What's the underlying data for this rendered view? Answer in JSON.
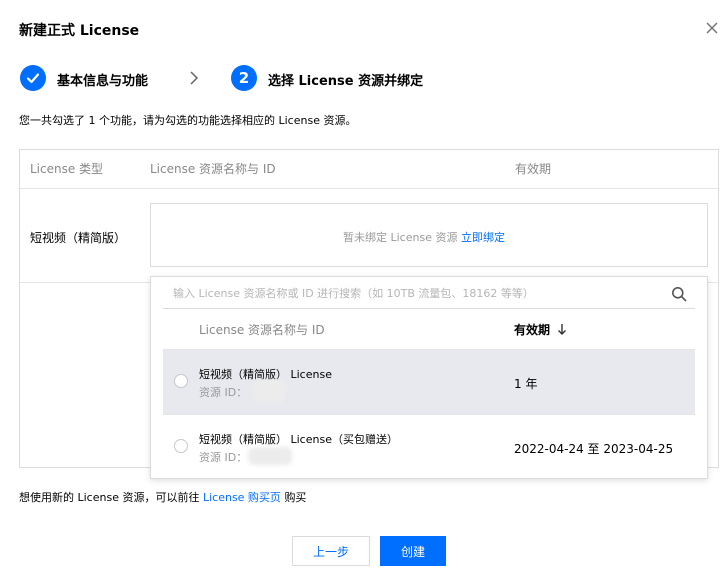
{
  "dialog": {
    "title": "新建正式 License",
    "close_icon": "close-icon"
  },
  "steps": [
    {
      "index": "1",
      "label": "基本信息与功能",
      "state": "done",
      "icon": "check-icon"
    },
    {
      "index": "2",
      "label": "选择 License 资源并绑定",
      "state": "active"
    }
  ],
  "description": "您一共勾选了 1 个功能，请为勾选的功能选择相应的 License 资源。",
  "table": {
    "headers": [
      "License 类型",
      "License 资源名称与 ID",
      "有效期"
    ],
    "row": {
      "type": "短视频（精简版）",
      "unbound_text": "暂未绑定 License 资源",
      "bind_link": "立即绑定"
    }
  },
  "dropdown": {
    "search_placeholder": "输入 License 资源名称或 ID 进行搜索（如 10TB 流量包、18162 等等）",
    "search_value": "",
    "headers": {
      "name": "License 资源名称与 ID",
      "validity": "有效期"
    },
    "options": [
      {
        "name": "短视频（精简版） License",
        "id_label": "资源 ID：",
        "validity": "1 年",
        "selected": false,
        "hovered": true
      },
      {
        "name": "短视频（精简版） License（买包赠送）",
        "id_label": "资源 ID：",
        "validity": "2022-04-24 至 2023-04-25",
        "selected": false,
        "hovered": false
      }
    ]
  },
  "footer": {
    "note_prefix": "想使用新的 License 资源，可以前往",
    "note_link": "License 购买页",
    "note_suffix": "购买",
    "prev_button": "上一步",
    "create_button": "创建"
  },
  "colors": {
    "accent": "#006eff",
    "hover_row": "#e7e9ee",
    "border": "#dcdcdc"
  }
}
